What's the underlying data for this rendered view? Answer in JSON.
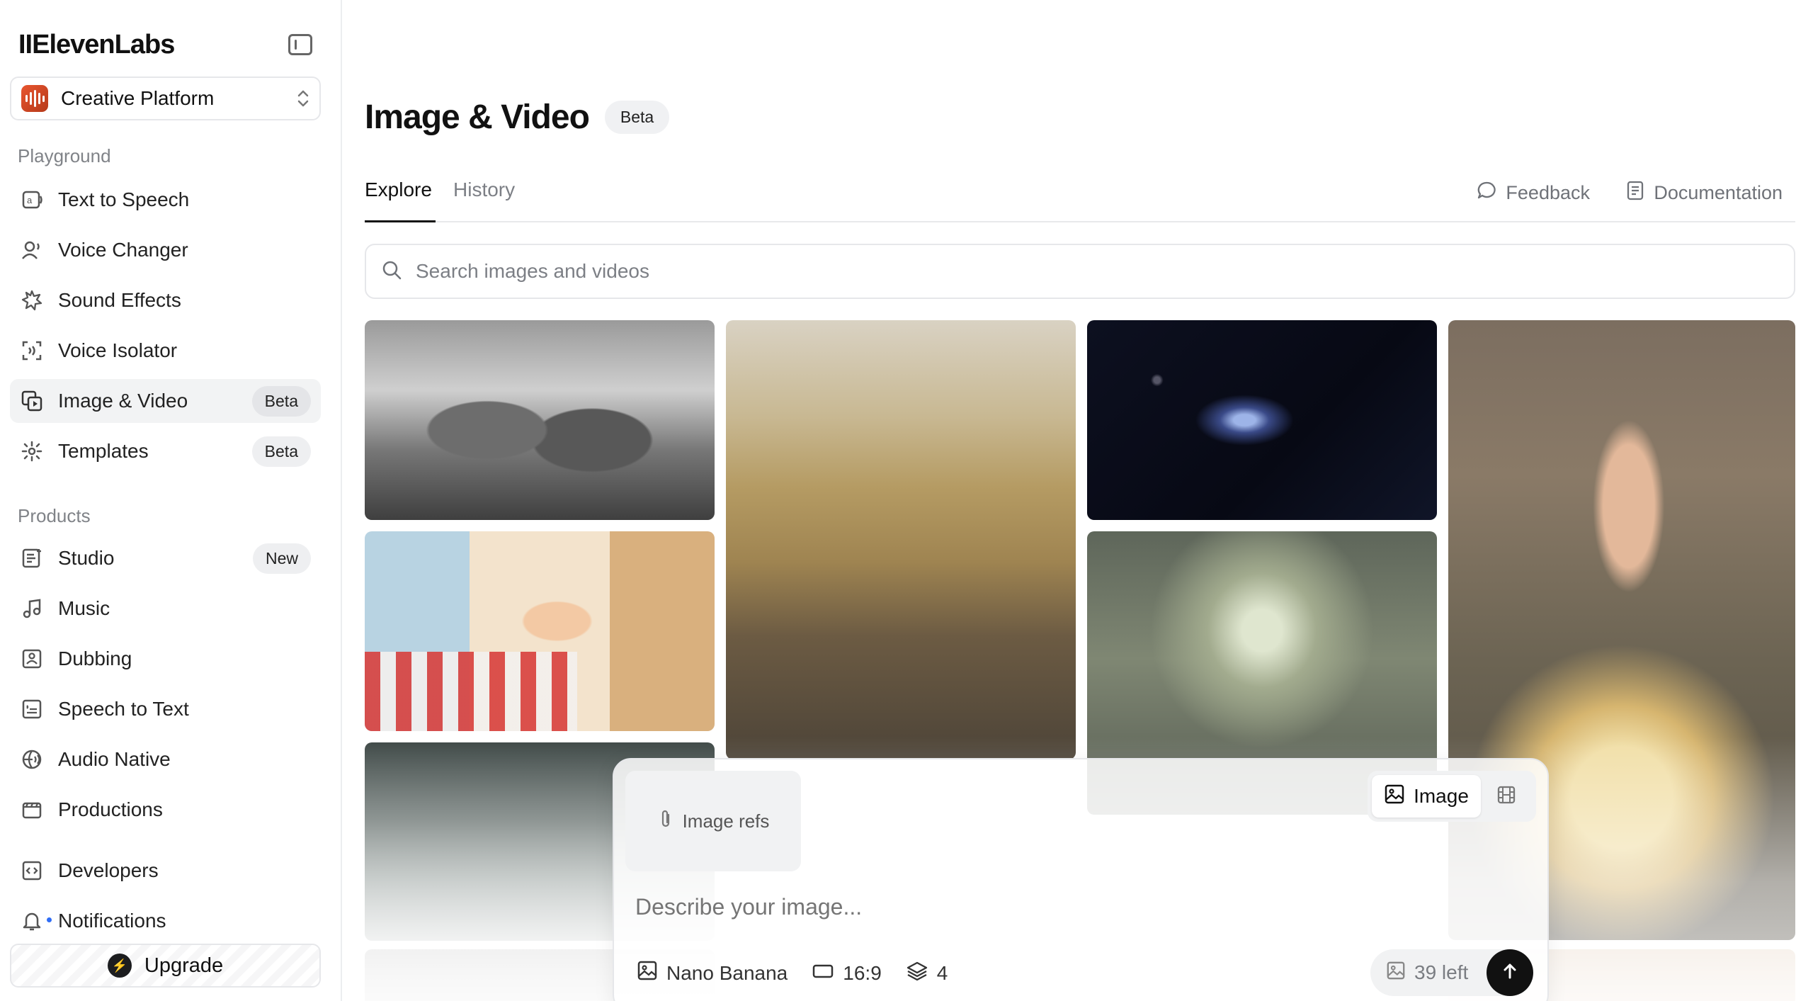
{
  "brand": {
    "logo": "IIElevenLabs"
  },
  "workspace": {
    "label": "Creative Platform"
  },
  "sidebar": {
    "playground_label": "Playground",
    "playground": [
      {
        "label": "Text to Speech",
        "badge": ""
      },
      {
        "label": "Voice Changer",
        "badge": ""
      },
      {
        "label": "Sound Effects",
        "badge": ""
      },
      {
        "label": "Voice Isolator",
        "badge": ""
      },
      {
        "label": "Image & Video",
        "badge": "Beta"
      },
      {
        "label": "Templates",
        "badge": "Beta"
      }
    ],
    "products_label": "Products",
    "products": [
      {
        "label": "Studio",
        "badge": "New"
      },
      {
        "label": "Music",
        "badge": ""
      },
      {
        "label": "Dubbing",
        "badge": ""
      },
      {
        "label": "Speech to Text",
        "badge": ""
      },
      {
        "label": "Audio Native",
        "badge": ""
      },
      {
        "label": "Productions",
        "badge": ""
      }
    ],
    "bottom": [
      {
        "label": "Developers"
      },
      {
        "label": "Notifications"
      }
    ],
    "upgrade_label": "Upgrade"
  },
  "main": {
    "title": "Image & Video",
    "title_badge": "Beta",
    "tabs": [
      {
        "label": "Explore"
      },
      {
        "label": "History"
      }
    ],
    "feedback_label": "Feedback",
    "documentation_label": "Documentation",
    "search_placeholder": "Search images and videos"
  },
  "composer": {
    "image_refs_label": "Image refs",
    "mode_image_label": "Image",
    "prompt_placeholder": "Describe your image...",
    "model": "Nano Banana",
    "aspect_ratio": "16:9",
    "count": "4",
    "credits": "39 left"
  },
  "colors": {
    "accent": "#111111",
    "notification_dot": "#2f6df6",
    "workspace_icon": "#e8552f"
  }
}
